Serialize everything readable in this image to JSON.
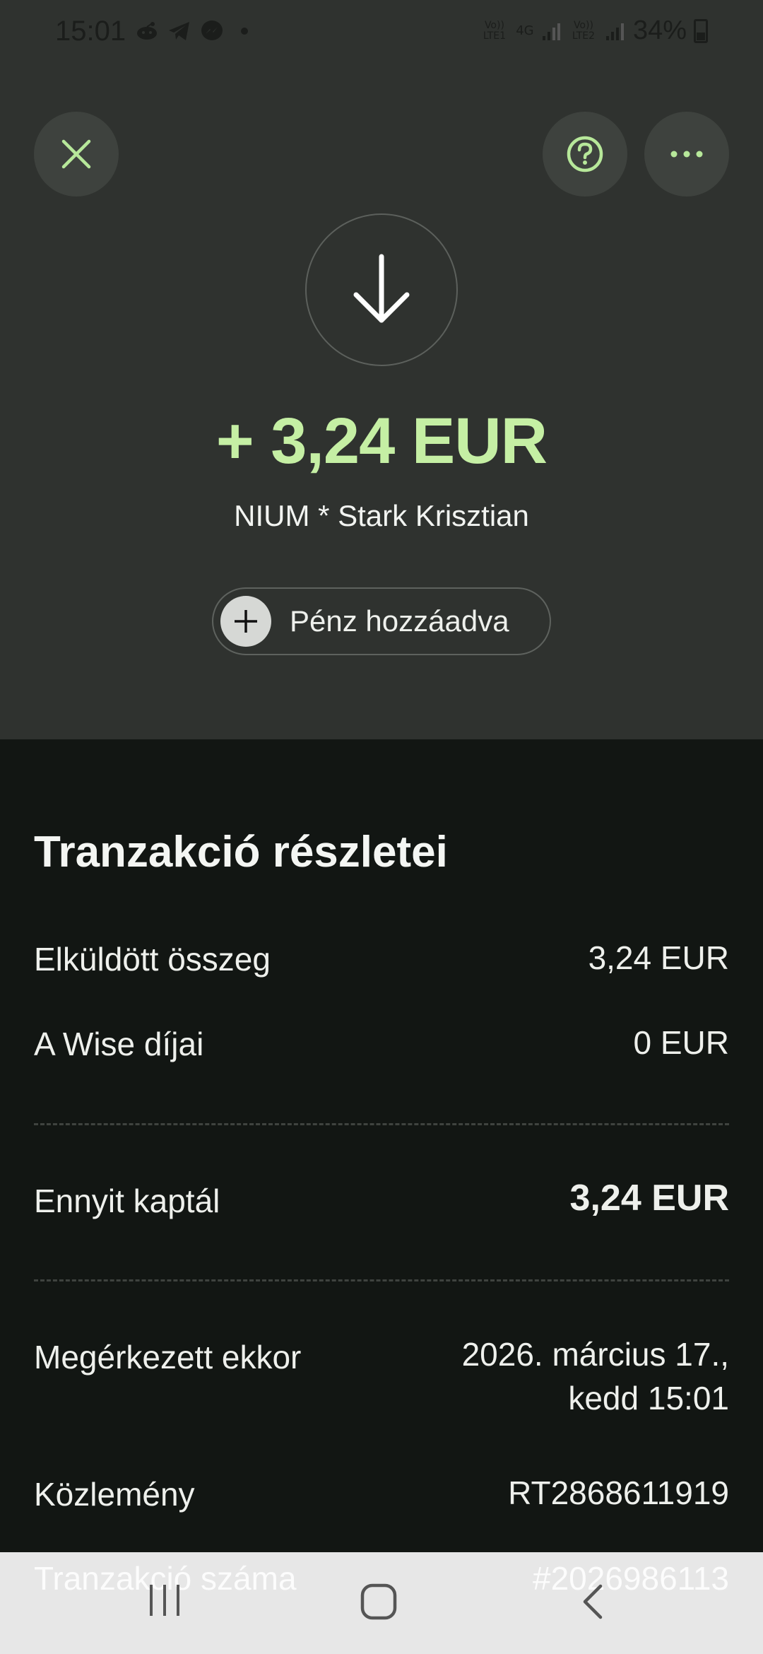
{
  "status_bar": {
    "time": "15:01",
    "network1": "Vo)) LTE1",
    "network_type": "4G",
    "network2": "Vo)) LTE2",
    "battery": "34%"
  },
  "header": {
    "close_icon": "close-icon",
    "help_icon": "question-circle-icon",
    "more_icon": "more-dots-icon",
    "direction_icon": "arrow-down-icon"
  },
  "transaction": {
    "amount": "+ 3,24 EUR",
    "counterparty": "NIUM * Stark Krisztian",
    "status_label": "Pénz hozzáadva",
    "accent_color": "#c5efa4"
  },
  "details": {
    "title": "Tranzakció részletei",
    "rows": [
      {
        "label": "Elküldött összeg",
        "value": "3,24 EUR"
      },
      {
        "label": "A Wise díjai",
        "value": "0 EUR"
      },
      {
        "label": "Ennyit kaptál",
        "value": "3,24 EUR"
      },
      {
        "label": "Megérkezett ekkor",
        "value_line1": "2026. március 17.,",
        "value_line2": "kedd 15:01"
      },
      {
        "label": "Közlemény",
        "value": "RT2868611919"
      },
      {
        "label": "Tranzakció száma",
        "value": "#2026986113"
      }
    ]
  },
  "navbar": {
    "recents_icon": "recents-icon",
    "home_icon": "home-icon",
    "back_icon": "back-icon"
  }
}
